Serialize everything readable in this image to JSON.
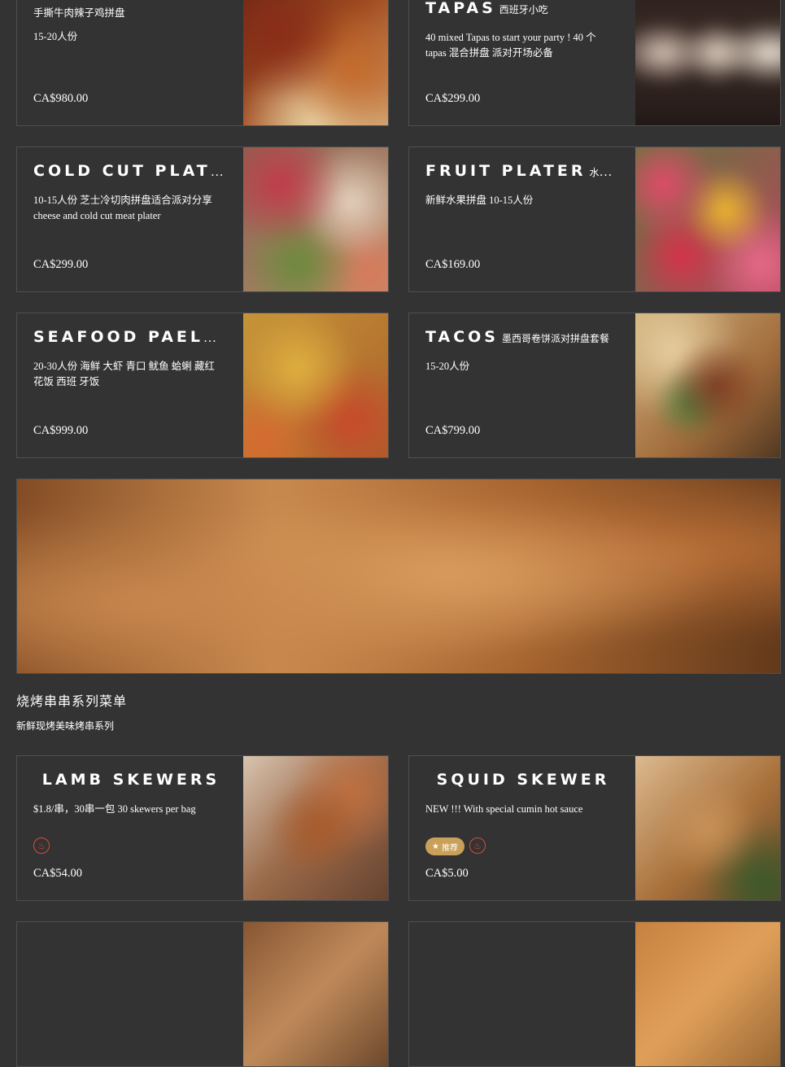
{
  "colors": {
    "background": "#333333",
    "card_border": "#4f4f4f",
    "spicy": "#d94a3a",
    "chef_badge": "#c9a05a"
  },
  "cards": [
    {
      "title": "",
      "title_cn": "",
      "desc": "手撕牛肉辣子鸡拼盘\n15-20人份",
      "price": "CA$980.00",
      "photo": "platter-food-photo"
    },
    {
      "title": "Tapas",
      "title_cn": "西班牙小吃",
      "desc": "40 mixed Tapas to start your party ! 40 个 tapas 混合拼盘 派对开场必备",
      "price": "CA$299.00",
      "photo": "tapas-food-photo"
    },
    {
      "title": "Cold Cut Plater",
      "title_cn": "",
      "desc": "10-15人份 芝士冷切肉拼盘适合派对分享 cheese and cold cut meat plater",
      "price": "CA$299.00",
      "photo": "cold-cut-photo"
    },
    {
      "title": "Fruit Plater",
      "title_cn": "水果拼盘",
      "desc": "新鲜水果拼盘 10-15人份",
      "price": "CA$169.00",
      "photo": "fruit-photo"
    },
    {
      "title": "Seafood Paella",
      "title_cn": "",
      "desc": "20-30人份 海鲜 大虾 青口 鱿鱼 蛤蜊 藏红 花饭 西班 牙饭",
      "price": "CA$999.00",
      "photo": "paella-photo"
    },
    {
      "title": "Tacos",
      "title_cn": "墨西哥卷饼派对拼盘套餐",
      "desc": "15-20人份",
      "price": "CA$799.00",
      "photo": "tacos-photo"
    },
    {
      "title": "Lamb Skewers",
      "title_cn": "",
      "desc": "$1.8/串，30串一包 30 skewers per bag",
      "price": "CA$54.00",
      "photo": "lamb-skewer-photo",
      "badges": [
        "spicy"
      ]
    },
    {
      "title": "Squid Skewer",
      "title_cn": "",
      "desc": "NEW !!! With special cumin hot sauce",
      "price": "CA$5.00",
      "photo": "squid-photo",
      "badges": [
        "chef",
        "spicy"
      ],
      "chef_label": "推荐"
    }
  ],
  "section": {
    "title": "烧烤串串系列菜单",
    "subtitle": "新鲜现烤美味烤串系列"
  },
  "banner": {
    "alt": "grilled skewers banner"
  }
}
